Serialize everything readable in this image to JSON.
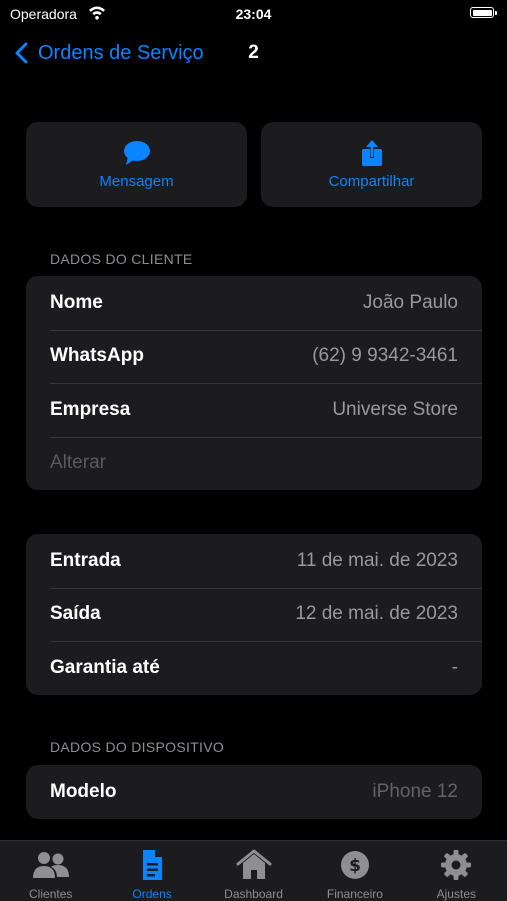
{
  "status_bar": {
    "carrier": "Operadora",
    "time": "23:04"
  },
  "nav": {
    "back_label": "Ordens de Serviço",
    "title": "2"
  },
  "actions": [
    {
      "label": "Mensagem",
      "icon": "message-icon"
    },
    {
      "label": "Compartilhar",
      "icon": "share-icon"
    }
  ],
  "client_section": {
    "header": "DADOS DO CLIENTE",
    "rows": [
      {
        "label": "Nome",
        "value": "João Paulo"
      },
      {
        "label": "WhatsApp",
        "value": "(62) 9 9342-3461"
      },
      {
        "label": "Empresa",
        "value": "Universe Store"
      }
    ],
    "action": "Alterar"
  },
  "dates_section": {
    "rows": [
      {
        "label": "Entrada",
        "value": "11 de mai. de 2023"
      },
      {
        "label": "Saída",
        "value": "12 de mai. de 2023"
      },
      {
        "label": "Garantia até",
        "value": "-"
      }
    ]
  },
  "device_section": {
    "header": "DADOS DO DISPOSITIVO",
    "rows": [
      {
        "label": "Modelo",
        "value": "iPhone 12"
      }
    ]
  },
  "tabs": [
    {
      "label": "Clientes",
      "icon": "people-icon",
      "active": false
    },
    {
      "label": "Ordens",
      "icon": "document-icon",
      "active": true
    },
    {
      "label": "Dashboard",
      "icon": "house-icon",
      "active": false
    },
    {
      "label": "Financeiro",
      "icon": "dollar-icon",
      "active": false
    },
    {
      "label": "Ajustes",
      "icon": "gear-icon",
      "active": false
    }
  ],
  "colors": {
    "accent": "#0a84ff",
    "background": "#000000",
    "cell": "#1c1c1e",
    "secondary_text": "#8e8e93"
  }
}
